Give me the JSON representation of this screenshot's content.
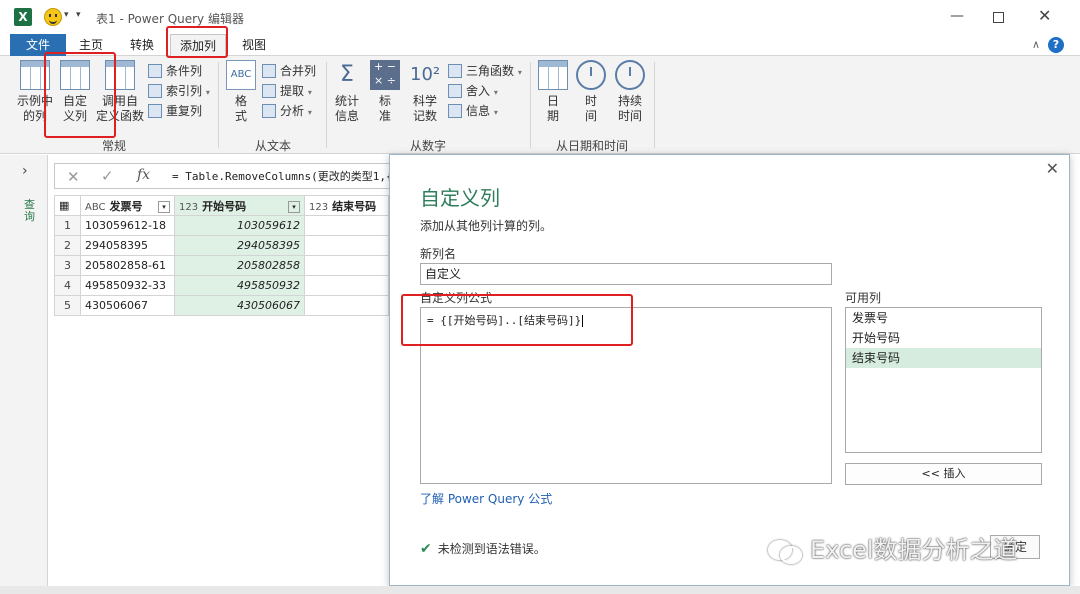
{
  "window": {
    "title": "表1 - Power Query 编辑器",
    "app_icon": "X"
  },
  "tabs": [
    {
      "label": "文件"
    },
    {
      "label": "主页"
    },
    {
      "label": "转换"
    },
    {
      "label": "添加列"
    },
    {
      "label": "视图"
    }
  ],
  "ribbon": {
    "groups": {
      "general": "常规",
      "from_text": "从文本",
      "from_number": "从数字",
      "from_datetime": "从日期和时间"
    },
    "buttons": {
      "example_col": "示例中\n的列",
      "custom_col": "自定\n义列",
      "invoke_func": "调用自\n定义函数",
      "cond_col": "条件列",
      "index_col": "索引列",
      "dup_col": "重复列",
      "format": "格\n式",
      "merge_col": "合并列",
      "extract": "提取",
      "parse": "分析",
      "stats": "统计\n信息",
      "standard": "标\n准",
      "scientific": "科学\n记数",
      "trig": "三角函数",
      "round": "舍入",
      "info": "信息",
      "date": "日\n期",
      "time": "时\n间",
      "duration": "持续\n时间"
    }
  },
  "left_panel": {
    "label": "查询"
  },
  "formula_bar": {
    "text": "= Table.RemoveColumns(更改的类型1,{"
  },
  "grid": {
    "columns": [
      {
        "type": "ABC",
        "name": "发票号"
      },
      {
        "type": "123",
        "name": "开始号码"
      },
      {
        "type": "123",
        "name": "结束号码"
      }
    ],
    "rows": [
      {
        "n": "1",
        "invoice": "103059612-18",
        "start": "103059612"
      },
      {
        "n": "2",
        "invoice": "294058395",
        "start": "294058395"
      },
      {
        "n": "3",
        "invoice": "205802858-61",
        "start": "205802858"
      },
      {
        "n": "4",
        "invoice": "495850932-33",
        "start": "495850932"
      },
      {
        "n": "5",
        "invoice": "430506067",
        "start": "430506067"
      }
    ]
  },
  "dialog": {
    "title": "自定义列",
    "subtitle": "添加从其他列计算的列。",
    "new_col_label": "新列名",
    "new_col_value": "自定义",
    "formula_label": "自定义列公式",
    "formula_value": "= {[开始号码]..[结束号码]}",
    "available_label": "可用列",
    "available": [
      "发票号",
      "开始号码",
      "结束号码"
    ],
    "insert_label": "<< 插入",
    "learn_link": "了解 Power Query 公式",
    "status": "未检测到语法错误。",
    "ok_label": "确定"
  },
  "watermark": {
    "text": "Excel数据分析之道"
  }
}
